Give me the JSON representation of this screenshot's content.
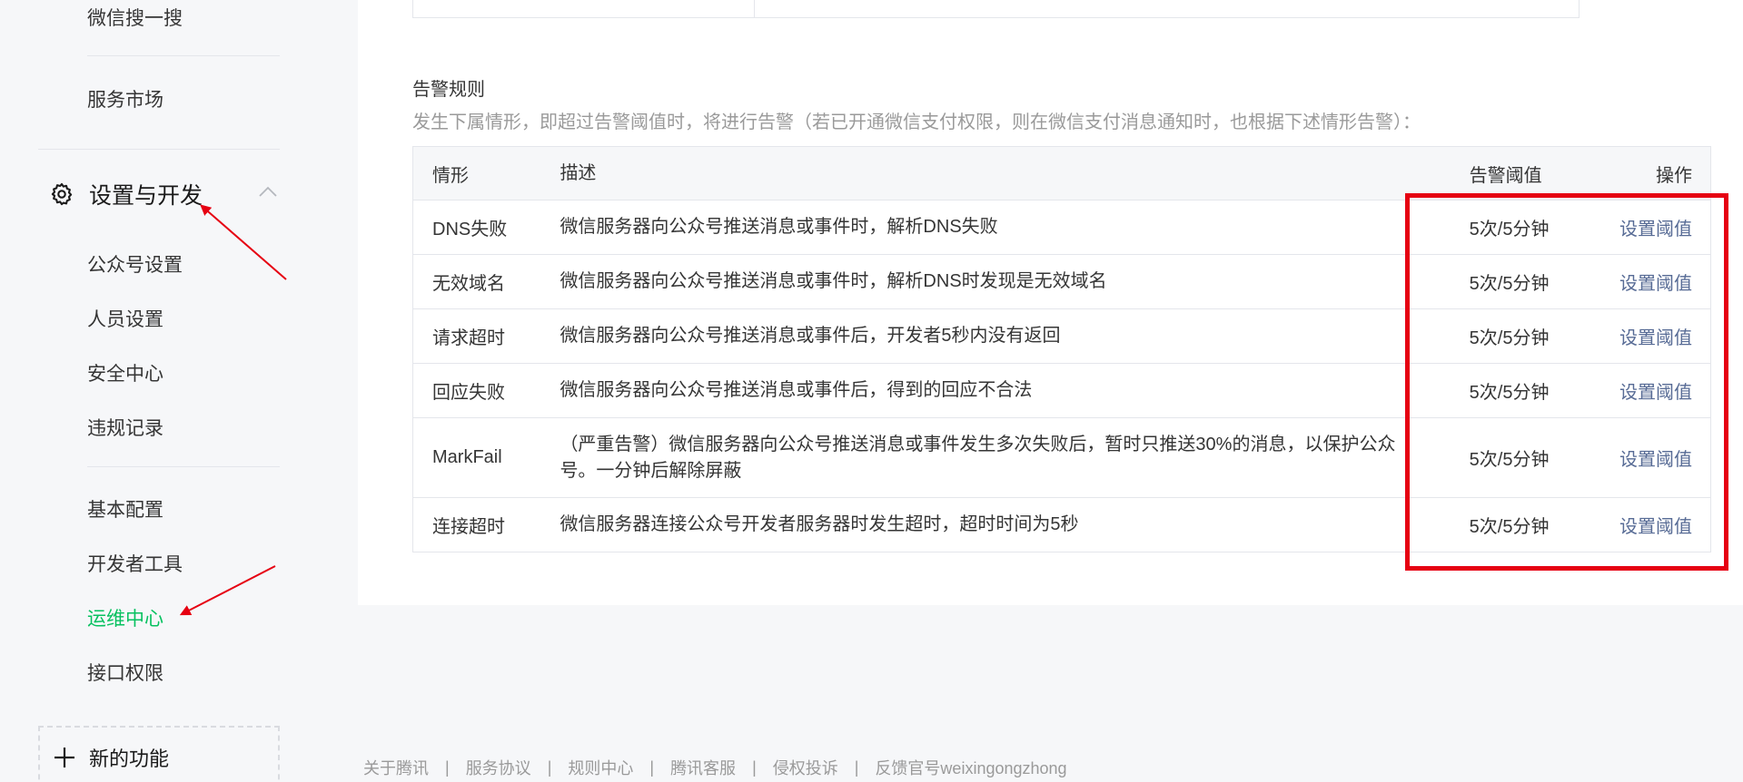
{
  "sidebar": {
    "items_top": [
      "微信搜一搜",
      "服务市场"
    ],
    "group": {
      "title": "设置与开发",
      "icon": "gear-icon"
    },
    "items_settings": [
      "公众号设置",
      "人员设置",
      "安全中心",
      "违规记录"
    ],
    "items_dev": [
      "基本配置",
      "开发者工具",
      "运维中心",
      "接口权限"
    ],
    "active_item": "运维中心",
    "new_feature": "新的功能",
    "active_color": "#07c160"
  },
  "rules": {
    "title": "告警规则",
    "description": "发生下属情形，即超过告警阈值时，将进行告警（若已开通微信支付权限，则在微信支付消息通知时，也根据下述情形告警）：",
    "headers": [
      "情形",
      "描述",
      "告警阈值",
      "操作"
    ],
    "rows": [
      {
        "case": "DNS失败",
        "desc": "微信服务器向公众号推送消息或事件时，解析DNS失败",
        "threshold": "5次/5分钟",
        "action": "设置阈值"
      },
      {
        "case": "无效域名",
        "desc": "微信服务器向公众号推送消息或事件时，解析DNS时发现是无效域名",
        "threshold": "5次/5分钟",
        "action": "设置阈值"
      },
      {
        "case": "请求超时",
        "desc": "微信服务器向公众号推送消息或事件后，开发者5秒内没有返回",
        "threshold": "5次/5分钟",
        "action": "设置阈值"
      },
      {
        "case": "回应失败",
        "desc": "微信服务器向公众号推送消息或事件后，得到的回应不合法",
        "threshold": "5次/5分钟",
        "action": "设置阈值"
      },
      {
        "case": "MarkFail",
        "desc": "（严重告警）微信服务器向公众号推送消息或事件发生多次失败后，暂时只推送30%的消息，以保护公众号。一分钟后解除屏蔽",
        "threshold": "5次/5分钟",
        "action": "设置阈值"
      },
      {
        "case": "连接超时",
        "desc": "微信服务器连接公众号开发者服务器时发生超时，超时时间为5秒",
        "threshold": "5次/5分钟",
        "action": "设置阈值"
      }
    ],
    "link_color": "#576b95"
  },
  "footer": {
    "links": [
      "关于腾讯",
      "服务协议",
      "规则中心",
      "腾讯客服",
      "侵权投诉",
      "反馈官号weixingongzhong"
    ],
    "separator": "|"
  },
  "annotation_color": "#e60012"
}
